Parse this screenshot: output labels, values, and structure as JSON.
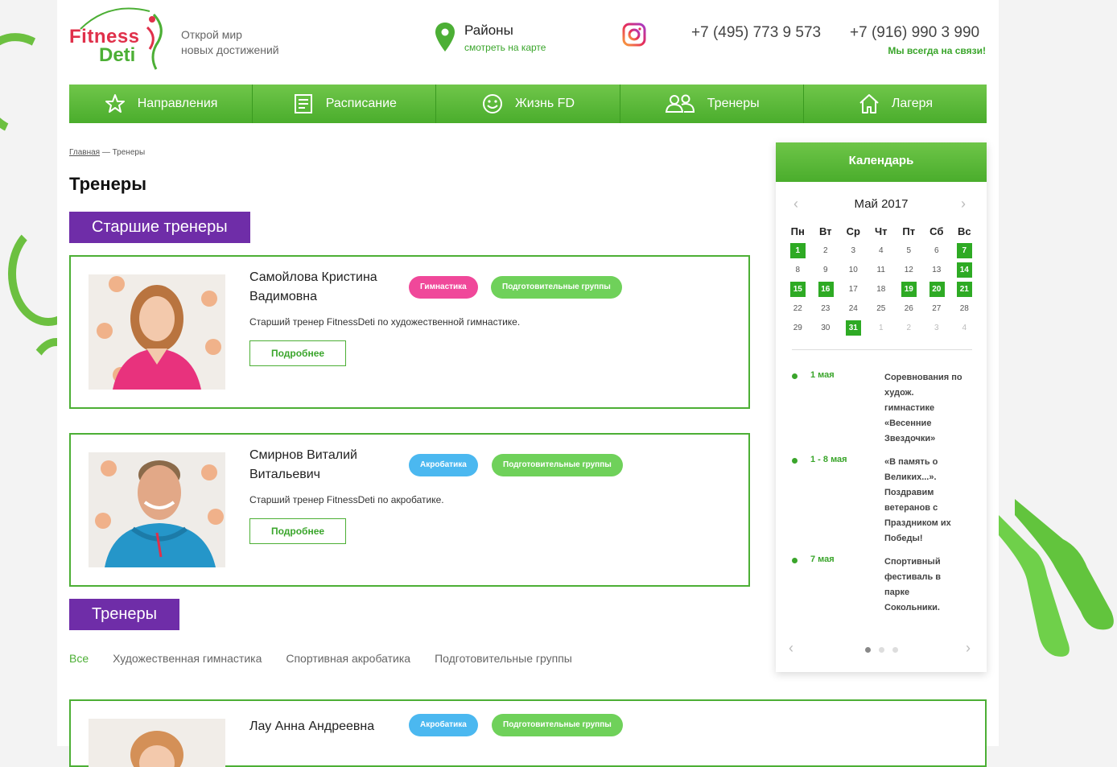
{
  "header": {
    "logo_line1": "Fitness",
    "logo_line2": "Deti",
    "slogan_line1": "Открой мир",
    "slogan_line2": "новых достижений",
    "districts_title": "Районы",
    "districts_link": "смотреть на карте",
    "phone1": "+7 (495) 773 9 573",
    "phone2": "+7 (916) 990 3 990",
    "contact_note": "Мы всегда на связи!"
  },
  "nav": [
    {
      "label": "Направления",
      "icon": "star-icon"
    },
    {
      "label": "Расписание",
      "icon": "schedule-icon"
    },
    {
      "label": "Жизнь FD",
      "icon": "smile-icon"
    },
    {
      "label": "Тренеры",
      "icon": "people-icon"
    },
    {
      "label": "Лагеря",
      "icon": "home-icon"
    }
  ],
  "breadcrumb": {
    "home": "Главная",
    "separator": "—",
    "current": "Тренеры"
  },
  "page_title": "Тренеры",
  "senior_section": "Старшие тренеры",
  "trainers_section": "Тренеры",
  "trainers": [
    {
      "name": "Самойлова Кристина Вадимовна",
      "badge1": "Гимнастика",
      "badge2": "Подготовительные группы",
      "desc": "Старший тренер FitnessDeti по художественной гимнастике.",
      "button": "Подробнее"
    },
    {
      "name": "Смирнов Виталий Витальевич",
      "badge1": "Акробатика",
      "badge2": "Подготовительные группы",
      "desc": "Старший тренер FitnessDeti по акробатике.",
      "button": "Подробнее"
    },
    {
      "name": "Лау Анна Андреевна",
      "badge1": "Акробатика",
      "badge2": "Подготовительные группы"
    }
  ],
  "filters": [
    "Все",
    "Художественная гимнастика",
    "Спортивная акробатика",
    "Подготовительные группы"
  ],
  "calendar": {
    "title": "Календарь",
    "month": "Май 2017",
    "weekdays": [
      "Пн",
      "Вт",
      "Ср",
      "Чт",
      "Пт",
      "Сб",
      "Вс"
    ],
    "weeks": [
      [
        "1",
        "2",
        "3",
        "4",
        "5",
        "6",
        "7"
      ],
      [
        "8",
        "9",
        "10",
        "11",
        "12",
        "13",
        "14"
      ],
      [
        "15",
        "16",
        "17",
        "18",
        "19",
        "20",
        "21"
      ],
      [
        "22",
        "23",
        "24",
        "25",
        "26",
        "27",
        "28"
      ],
      [
        "29",
        "30",
        "31",
        "1",
        "2",
        "3",
        "4"
      ]
    ],
    "highlighted": [
      "1",
      "7",
      "14",
      "15",
      "16",
      "19",
      "20",
      "21",
      "31"
    ],
    "events": [
      {
        "date": "1 мая",
        "text": "Соревнования по худож. гимнастике «Весенние Звездочки»"
      },
      {
        "date": "1 - 8 мая",
        "text": "«В память о Великих...». Поздравим ветеранов с Праздником их Победы!"
      },
      {
        "date": "7 мая",
        "text": "Спортивный фестиваль в парке Сокольники."
      }
    ]
  },
  "colors": {
    "green": "#4caf35",
    "purple": "#6f2da8",
    "pink": "#f0489a",
    "blue": "#4bb8f0",
    "light_green": "#6fd15a"
  }
}
